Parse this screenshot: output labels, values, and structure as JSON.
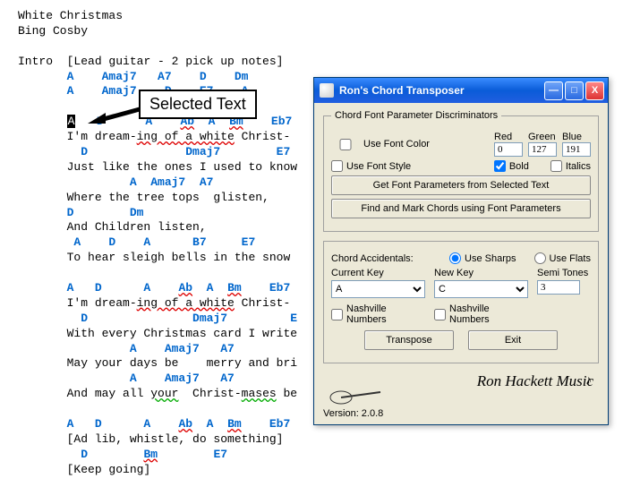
{
  "doc": {
    "title": "White Christmas",
    "artist": "Bing Cosby",
    "intro_label": "Intro",
    "intro_note": "[Lead guitar - 2 pick up notes]",
    "chord_rows": {
      "r1": "A    Amaj7   A7    D    Dm",
      "r2": "A    Amaj7    D    E7    A",
      "s1": "A   D      A    Ab  A  Bm    Eb7",
      "l1a": "I'm dream-",
      "l1b": "ing of a white",
      "l1c": " Christ-",
      "s2": "  D              Dmaj7        E7",
      "l2": "Just like the ones I used to know",
      "s3": "         A  Amaj7  A7",
      "l3": "Where the tree tops  glisten,",
      "s4": "D        Dm",
      "l4": "And Children listen,",
      "s5": " A    D    A      B7     E7",
      "l5": "To hear sleigh bells in the snow",
      "s6": "A   D      A    Ab  A  Bm    Eb7",
      "l6a": "I'm dream-",
      "l6b": "ing of a white",
      "l6c": " Christ-",
      "s7": "  D               Dmaj7         E",
      "l7": "With every Christmas card I write",
      "s8": "         A    Amaj7   A7",
      "l8": "May your days be    merry and bri",
      "s9": "         A    Amaj7   A7",
      "l9a": "And may all ",
      "l9b": "your",
      "l9c": "  Christ-",
      "l9d": "mases",
      "l9e": " be",
      "s10": "A   D      A    Ab  A  Bm    Eb7",
      "l10": "[Ad lib, whistle, do something]",
      "s11": "  D        Bm        E7",
      "l11": "[Keep going]"
    },
    "selected_chord": "A",
    "callout": "Selected Text"
  },
  "dialog": {
    "title": "Ron's Chord Transposer",
    "group_font": "Chord Font Parameter Discriminators",
    "use_font_color": "Use Font Color",
    "red_label": "Red",
    "green_label": "Green",
    "blue_label": "Blue",
    "red": "0",
    "green": "127",
    "blue": "191",
    "use_font_style": "Use Font Style",
    "bold": "Bold",
    "italics": "Italics",
    "btn_getparams": "Get Font Parameters from Selected Text",
    "btn_findmark": "Find and Mark Chords using Font Parameters",
    "accidentals_label": "Chord Accidentals:",
    "use_sharps": "Use Sharps",
    "use_flats": "Use Flats",
    "current_key_label": "Current Key",
    "new_key_label": "New Key",
    "semitones_label": "Semi Tones",
    "current_key": "A",
    "new_key": "C",
    "semitones": "3",
    "nashville": "Nashville Numbers",
    "btn_transpose": "Transpose",
    "btn_exit": "Exit",
    "brand": "Ron Hackett Music",
    "version_label": "Version: 2.0.8"
  }
}
